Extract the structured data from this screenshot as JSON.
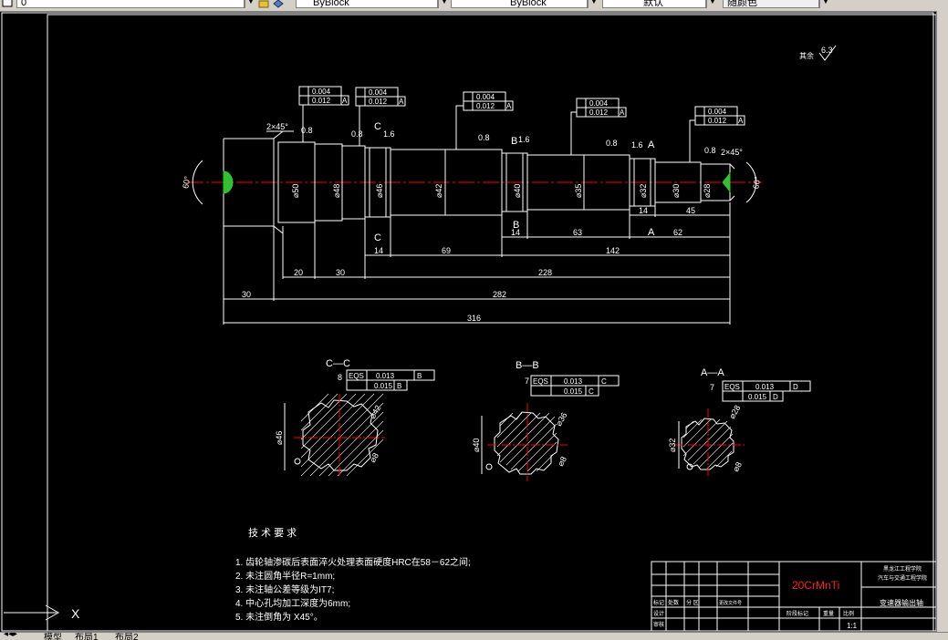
{
  "toolbar": {
    "layer_value": "0",
    "linetype_value": "ByBlock",
    "lineweight_value": "ByBlock",
    "plotstyle_value": "默认",
    "color_value": "随颜色"
  },
  "drawing": {
    "surface_roughness_other": "其余",
    "surface_roughness_value": "6.3",
    "sections": [
      {
        "title": "C—C",
        "key_width": "8",
        "fcf_sym": "EQS",
        "fcf1": "0.013",
        "fcf1_mod": "M",
        "fcf1_datum": "B",
        "fcf1_datum_mod": "M",
        "fcf2": "0.015",
        "fcf2_datum": "B",
        "outer_dia": "⌀46",
        "inner_dia": "⌀42",
        "hole": "⌀8"
      },
      {
        "title": "B—B",
        "key_width": "7",
        "fcf_sym": "EQS",
        "fcf1": "0.013",
        "fcf1_mod": "M",
        "fcf1_datum": "C",
        "fcf1_datum_mod": "M",
        "fcf2": "0.015",
        "fcf2_datum": "C",
        "outer_dia": "⌀40",
        "inner_dia": "⌀36",
        "hole": "⌀8"
      },
      {
        "title": "A—A",
        "key_width": "7",
        "fcf_sym": "EQS",
        "fcf1": "0.013",
        "fcf1_mod": "M",
        "fcf1_datum": "D",
        "fcf1_datum_mod": "M",
        "fcf2": "0.015",
        "fcf2_datum": "D",
        "outer_dia": "⌀32",
        "inner_dia": "⌀28",
        "hole": "⌀8"
      }
    ],
    "tech_title": "技 术 要 求",
    "tech_requirements": [
      "1. 齿轮轴渗碳后表面淬火处理表面硬度HRC在58－62之间;",
      "2. 未注圆角半径R=1mm;",
      "3. 未注轴公差等级为IT7;",
      "4. 中心孔均加工深度为6mm;",
      "5. 未注倒角为 X45°。"
    ],
    "dims": {
      "chamfer_left": "2×45°",
      "chamfer_right": "2×45°",
      "angle_left": "60°",
      "angle_right": "60°",
      "d_50": "⌀50",
      "d_48": "⌀48",
      "d_46": "⌀46",
      "d_42": "⌀42",
      "d_40": "⌀40",
      "d_35": "⌀35",
      "d_32": "⌀32",
      "d_30": "⌀30",
      "d_28": "⌀28",
      "len_14a": "14",
      "len_69": "69",
      "len_14b": "14",
      "len_63": "63",
      "len_142": "142",
      "len_14c": "14",
      "len_45": "45",
      "len_62": "62",
      "len_20": "20",
      "len_30a": "30",
      "len_228": "228",
      "len_30b": "30",
      "len_282": "282",
      "len_316": "316",
      "rough_08": "0.8",
      "rough_16": "1.6",
      "fcf_flat": "0.004",
      "fcf_runout": "0.012",
      "datum_a": "A",
      "label_A": "A",
      "label_B": "B",
      "label_C": "C"
    },
    "title_block": {
      "material": "20CrMnTi",
      "school": "黑龙江工程学院",
      "dept": "汽车与交通工程学院",
      "part_name": "变速器输出轴",
      "scale": "1:1",
      "labels": [
        "标记",
        "处数",
        "分 区",
        "更改文件号",
        "签名",
        "设计",
        "审核",
        "工艺",
        "标准化",
        "阶段标记",
        "重量",
        "比例",
        "批准"
      ]
    }
  },
  "ucs": {
    "x_label": "X"
  },
  "statusbar": {
    "tab_model": "模型",
    "tab_layout1": "布局1",
    "tab_layout2": "布局2"
  },
  "colors": {
    "background": "#000000",
    "lines": "#ffffff",
    "centerline": "#ff0000",
    "material_text": "#ff2020",
    "gui_gray": "#d4d0c8"
  }
}
